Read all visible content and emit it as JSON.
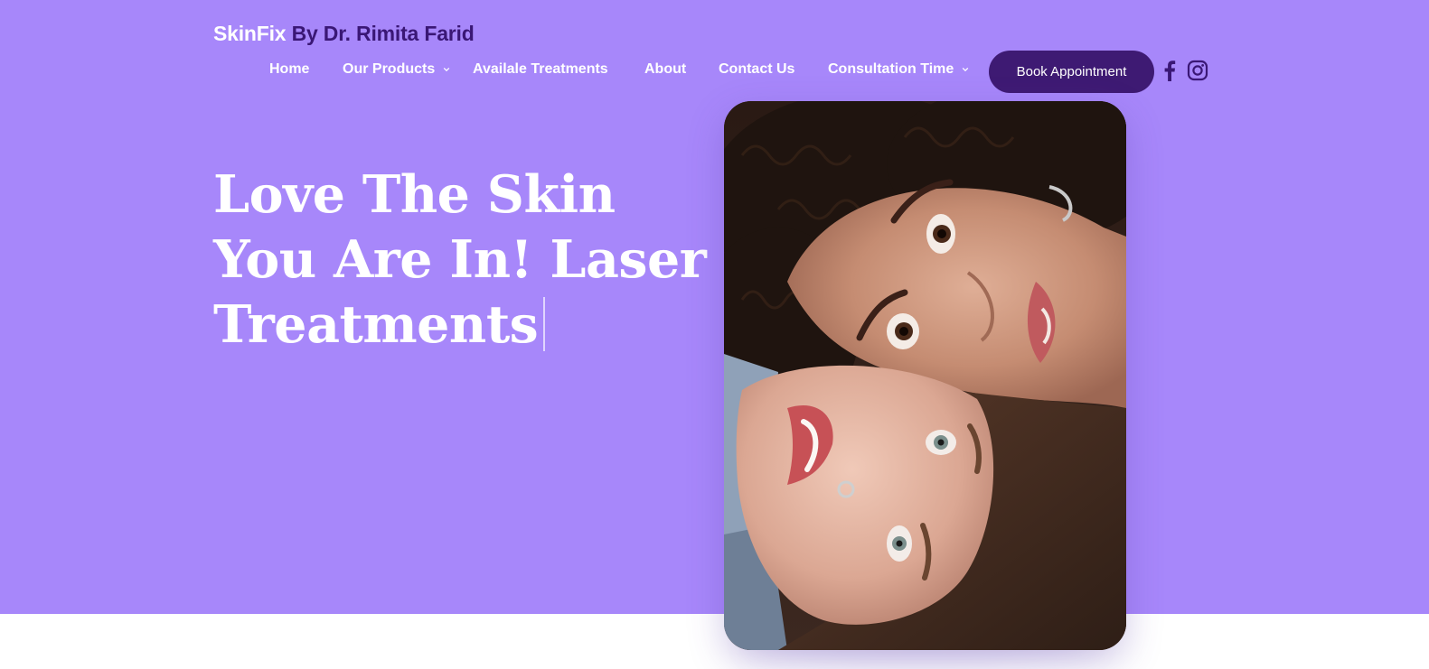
{
  "brand": {
    "part1": "SkinFix",
    "part2": " By Dr. Rimita Farid"
  },
  "nav": {
    "items": [
      {
        "label": "Home",
        "has_dropdown": false
      },
      {
        "label": "Our Products",
        "has_dropdown": true
      },
      {
        "label": "Availale Treatments",
        "has_dropdown": false
      },
      {
        "label": "About",
        "has_dropdown": false
      },
      {
        "label": "Contact Us",
        "has_dropdown": false
      },
      {
        "label": "Consultation Time",
        "has_dropdown": true
      }
    ],
    "cta_label": "Book Appointment"
  },
  "social": {
    "icons": [
      "facebook-icon",
      "instagram-icon"
    ]
  },
  "hero": {
    "headline_lines": [
      "Love The Skin",
      "You Are In! Laser",
      "Treatments"
    ],
    "image_subject": "two-women-faces-portrait"
  },
  "colors": {
    "hero_bg": "#a787fa",
    "brand_dark": "#3a1775",
    "button_bg": "#3e1a73",
    "text_light": "#ffffff"
  }
}
